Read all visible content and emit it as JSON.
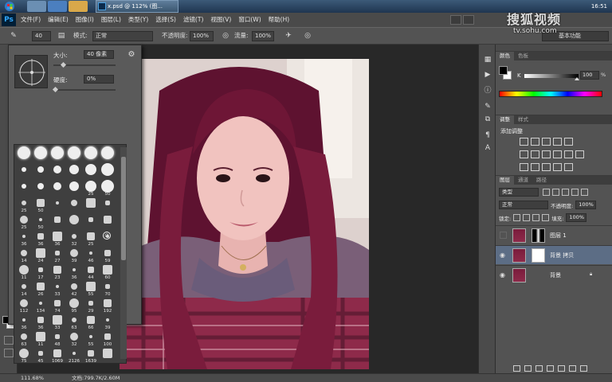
{
  "taskbar": {
    "active_window": "x.psd @ 112% (图...",
    "clock": "16:51"
  },
  "app": {
    "logo": "Ps",
    "menus": [
      "文件(F)",
      "编辑(E)",
      "图像(I)",
      "图层(L)",
      "类型(Y)",
      "选择(S)",
      "滤镜(T)",
      "视图(V)",
      "窗口(W)",
      "帮助(H)"
    ]
  },
  "options_bar": {
    "brush_size": "40",
    "mode_label": "模式:",
    "mode_value": "正常",
    "opacity_label": "不透明度:",
    "opacity_value": "100%",
    "flow_label": "流量:",
    "flow_value": "100%",
    "workspace": "基本功能"
  },
  "brush_picker": {
    "size_label": "大小:",
    "size_value": "40 像素",
    "hardness_label": "硬度:",
    "hardness_value": "0%",
    "size_fraction": 0.14,
    "hardness_fraction": 0.0,
    "sizes": [
      "",
      "",
      "",
      "",
      "",
      "",
      "",
      "",
      "",
      "",
      "",
      "",
      "",
      "",
      "",
      "",
      "25",
      "50",
      "25",
      "50",
      "",
      "",
      "",
      "",
      "25",
      "50",
      "",
      "",
      "",
      "",
      "36",
      "36",
      "36",
      "32",
      "25",
      "",
      "14",
      "24",
      "27",
      "39",
      "46",
      "59",
      "11",
      "17",
      "23",
      "36",
      "44",
      "60",
      "14",
      "26",
      "33",
      "42",
      "55",
      "70",
      "112",
      "134",
      "74",
      "95",
      "29",
      "192",
      "36",
      "36",
      "33",
      "63",
      "66",
      "39",
      "63",
      "11",
      "48",
      "32",
      "55",
      "100",
      "75",
      "45",
      "1069",
      "2126",
      "1639",
      "",
      "2042",
      "2106",
      "1918",
      "2066",
      "1809",
      "1212"
    ]
  },
  "color_panel": {
    "tabs": [
      "颜色",
      "色板"
    ],
    "channel": "K",
    "value": "100",
    "unit": "%",
    "value_fraction": 1.0
  },
  "adjustments_panel": {
    "tabs": [
      "调整",
      "样式"
    ],
    "title": "添加调整"
  },
  "layers_panel": {
    "tabs": [
      "图层",
      "通道",
      "路径"
    ],
    "filter": "类型",
    "blend_mode": "正常",
    "opacity_label": "不透明度:",
    "opacity_value": "100%",
    "lock_label": "锁定:",
    "fill_label": "填充:",
    "fill_value": "100%",
    "layers": [
      {
        "name": "图层 1",
        "visible": false,
        "selected": false,
        "locked": false
      },
      {
        "name": "背景 拷贝",
        "visible": true,
        "selected": true,
        "locked": false
      },
      {
        "name": "背景",
        "visible": true,
        "selected": false,
        "locked": true
      }
    ]
  },
  "status_bar": {
    "zoom": "111.68%",
    "doc": "文档:799.7K/2.60M"
  },
  "watermark": {
    "main": "搜狐视频",
    "url": "tv.sohu.com"
  },
  "colors": {
    "photo_hair": "#7a1c3c",
    "photo_skin": "#f1c3bf",
    "photo_sweater": "#6a5c7a",
    "photo_plaid": "#8e2a4a",
    "selected_layer": "#5c6d85"
  }
}
